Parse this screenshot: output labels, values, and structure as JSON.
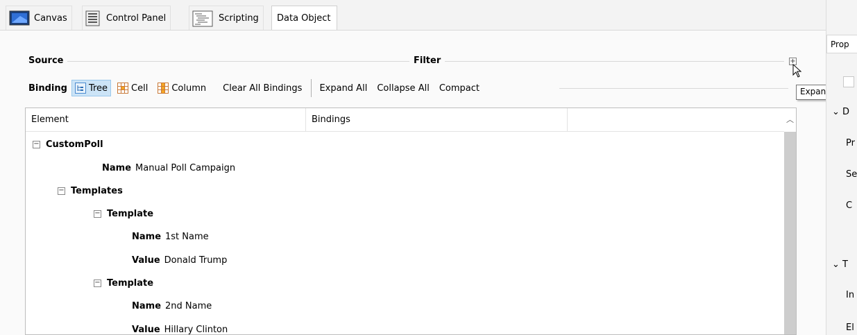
{
  "tabs": [
    {
      "label": "Canvas",
      "icon": "canvas-icon"
    },
    {
      "label": "Control Panel",
      "icon": "control-panel-icon"
    },
    {
      "label": "Scripting",
      "icon": "scripting-icon"
    },
    {
      "label": "Data Object",
      "icon": "",
      "active": true
    }
  ],
  "sections": {
    "source": "Source",
    "filter": "Filter"
  },
  "toolbar": {
    "binding_label": "Binding",
    "tree": "Tree",
    "cell": "Cell",
    "column": "Column",
    "clear_all": "Clear All Bindings",
    "expand_all": "Expand All",
    "collapse_all": "Collapse All",
    "compact": "Compact"
  },
  "filter_tooltip": "Expand",
  "tree": {
    "columns": [
      "Element",
      "Bindings"
    ],
    "rows": [
      {
        "expander": "⊟",
        "label": "CustomPoll",
        "value": ""
      },
      {
        "expander": "",
        "label": "Name",
        "value": "Manual Poll Campaign"
      },
      {
        "expander": "⊟",
        "label": "Templates",
        "value": ""
      },
      {
        "expander": "⊟",
        "label": "Template",
        "value": ""
      },
      {
        "expander": "",
        "label": "Name",
        "value": "1st Name"
      },
      {
        "expander": "",
        "label": "Value",
        "value": "Donald Trump"
      },
      {
        "expander": "⊟",
        "label": "Template",
        "value": ""
      },
      {
        "expander": "",
        "label": "Name",
        "value": "2nd Name"
      },
      {
        "expander": "",
        "label": "Value",
        "value": "Hillary Clinton"
      }
    ]
  },
  "right_panel": {
    "tab": "Prop",
    "items": [
      "D",
      "Pr",
      "Se",
      "C",
      "T",
      "In",
      "El"
    ]
  },
  "colors": {
    "selected_bg": "#cce4f7",
    "accent": "#0078d7"
  }
}
